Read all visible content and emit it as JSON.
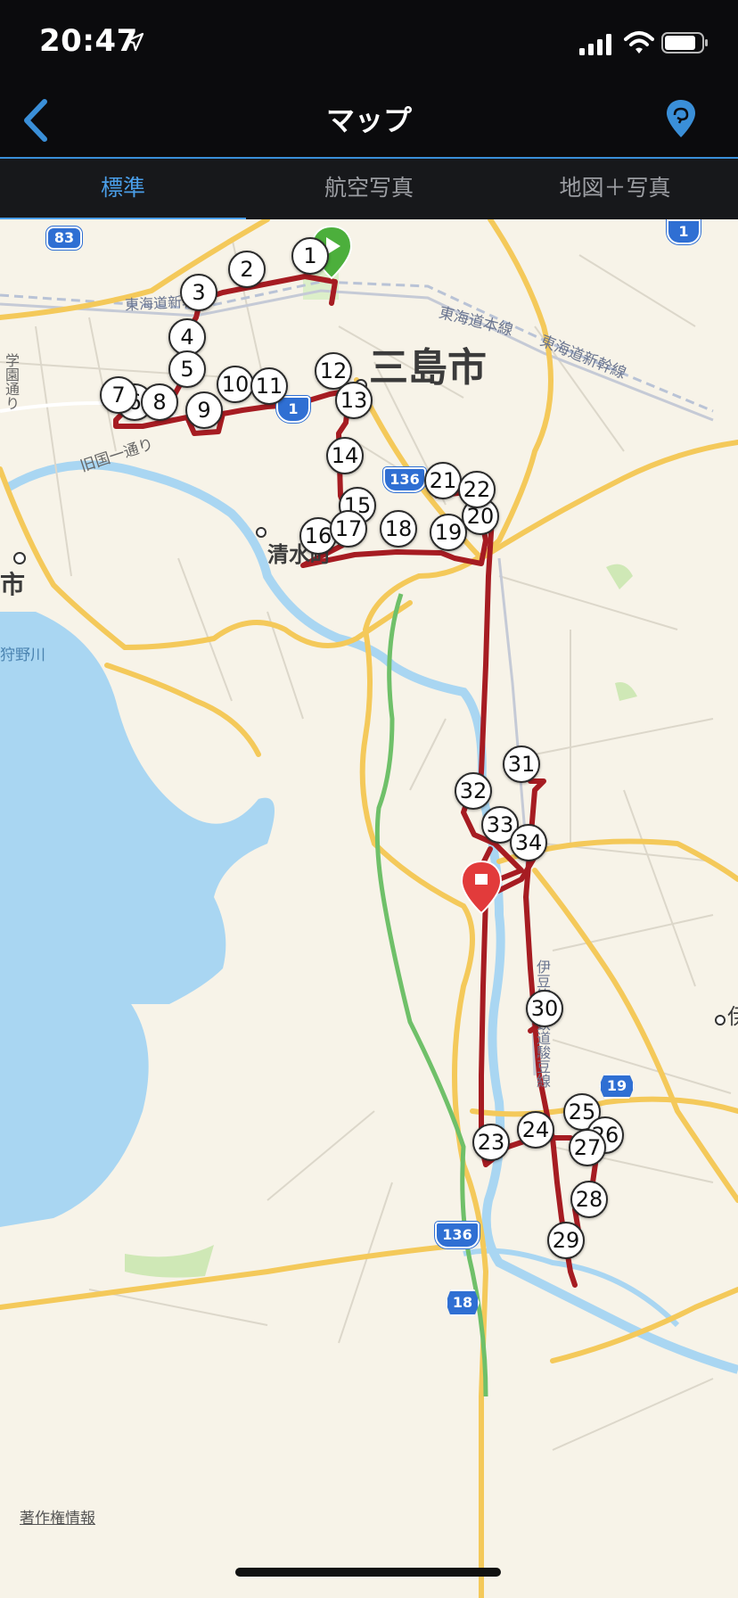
{
  "status_bar": {
    "time": "20:47"
  },
  "nav": {
    "title": "マップ"
  },
  "tabs": [
    {
      "label": "標準"
    },
    {
      "label": "航空写真"
    },
    {
      "label": "地図＋写真"
    }
  ],
  "map": {
    "place_labels": {
      "city_mishima": "三島市",
      "town_shimizu": "清水町",
      "edge_fragment": "市",
      "edge_fragment_right": "伊"
    },
    "road_labels": {
      "tokaido_left": "東海道新幹線",
      "tokaido_honsen": "東海道本線",
      "tokaido_shinkansen": "東海道新幹線",
      "kyukokudo": "旧国一通り",
      "gakuen": "学園通り",
      "kanogawa": "狩野川",
      "izuhakone": "伊豆箱根鉄道駿豆線"
    },
    "route_shields": [
      "83",
      "1",
      "1",
      "136",
      "136",
      "19",
      "18"
    ],
    "waypoints": [
      "1",
      "2",
      "3",
      "4",
      "5",
      "6",
      "7",
      "8",
      "9",
      "10",
      "11",
      "12",
      "13",
      "14",
      "15",
      "16",
      "17",
      "18",
      "19",
      "20",
      "21",
      "22",
      "23",
      "24",
      "25",
      "26",
      "27",
      "28",
      "29",
      "30",
      "31",
      "32",
      "33",
      "34"
    ],
    "copyright": "著作権情報",
    "colors": {
      "route": "#a61c22",
      "start_pin": "#4caf3c",
      "end_pin": "#e23b3b",
      "water": "#a9d6f2",
      "major_road": "#f4c95a"
    }
  }
}
